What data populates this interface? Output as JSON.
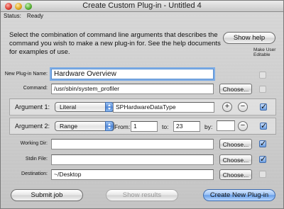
{
  "window": {
    "title": "Create Custom Plug-in - Untitled 4"
  },
  "status": {
    "label": "Status:",
    "value": "Ready"
  },
  "description": "Select the combination of command line arguments that describes the command you wish to make a new plug-in for.  See the help documents for examples of use.",
  "buttons": {
    "show_help": "Show help",
    "submit_job": "Submit job",
    "show_results": "Show results",
    "create_plugin": "Create New Plug-in",
    "choose": "Choose..."
  },
  "make_user_editable": "Make User Editable",
  "fields": {
    "plugin_name": {
      "label": "New Plug-in Name:",
      "value": "Hardware Overview"
    },
    "command": {
      "label": "Command:",
      "value": "/usr/sbin/system_profiler"
    },
    "working_dir": {
      "label": "Working Dir:",
      "value": ""
    },
    "stdin_file": {
      "label": "Stdin File:",
      "value": ""
    },
    "destination": {
      "label": "Destination:",
      "value": "~/Desktop"
    }
  },
  "arguments": [
    {
      "label": "Argument 1:",
      "type": "Literal",
      "value": "SPHardwareDataType"
    },
    {
      "label": "Argument 2:",
      "type": "Range",
      "from_label": "From:",
      "from": "1",
      "to_label": "to:",
      "to": "23",
      "by_label": "by:",
      "by": ""
    }
  ],
  "icons": {
    "plus": "+",
    "minus": "−"
  }
}
